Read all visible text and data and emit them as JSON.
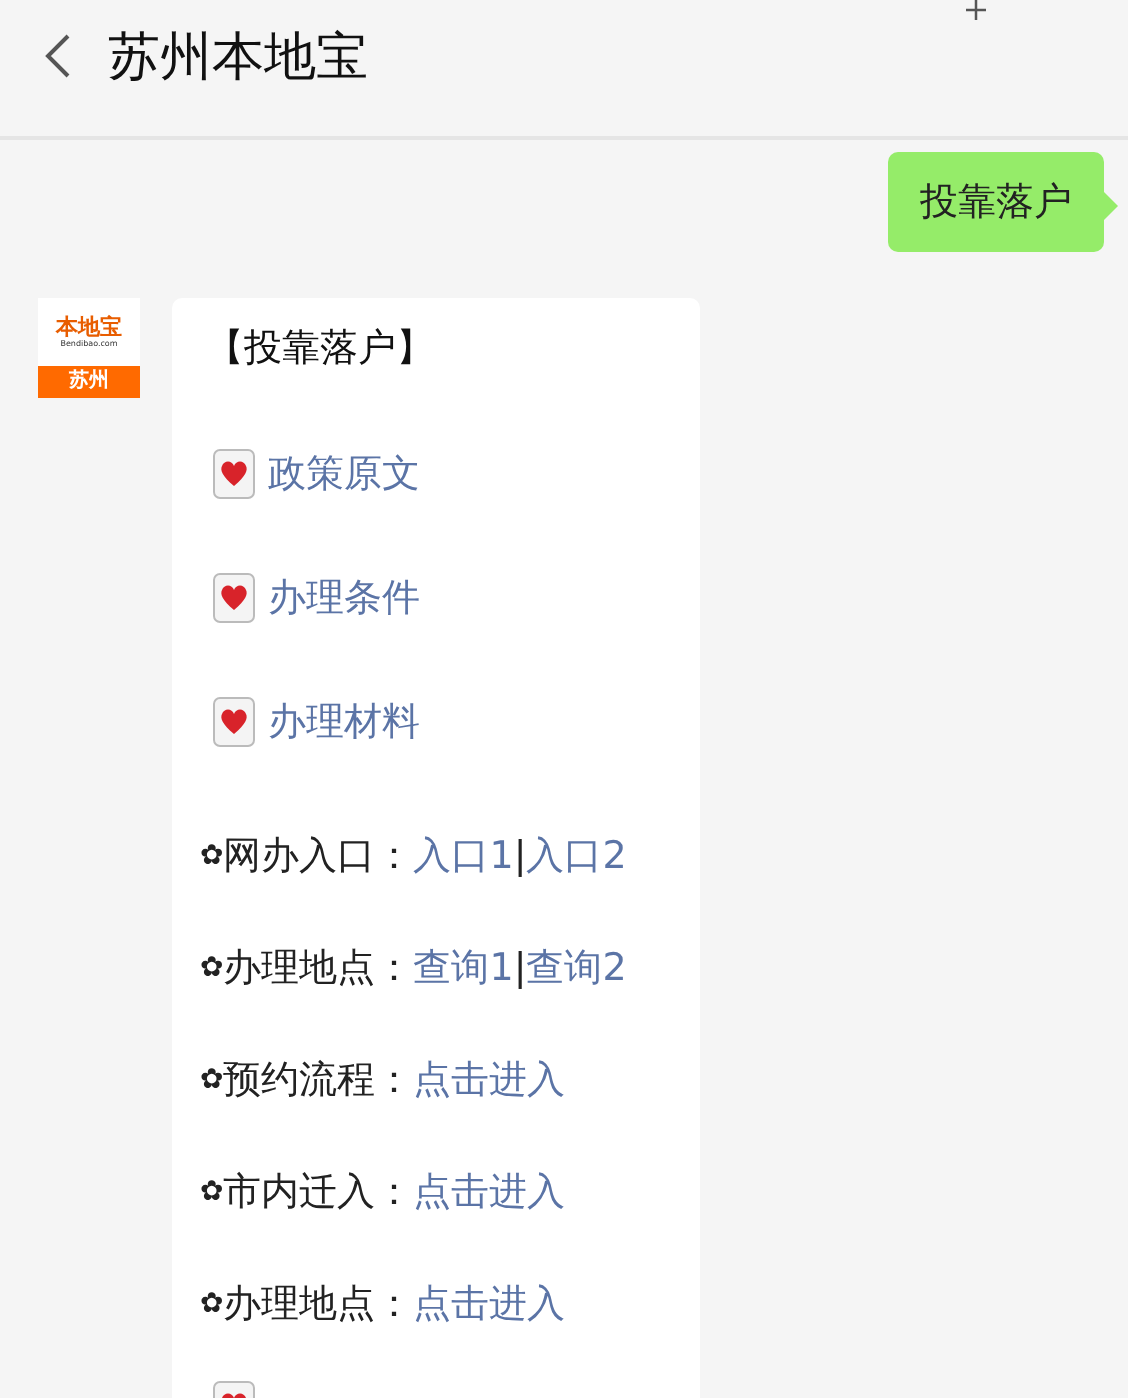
{
  "header": {
    "title": "苏州本地宝"
  },
  "outgoing_message": {
    "text": "投靠落户"
  },
  "incoming_message": {
    "avatar": {
      "brand": "本地宝",
      "domain": "Bendibao.com",
      "city": "苏州"
    },
    "title": "【投靠落户】",
    "items": [
      {
        "kind": "heart",
        "link": "政策原文"
      },
      {
        "kind": "heart",
        "link": "办理条件"
      },
      {
        "kind": "heart",
        "link": "办理材料"
      },
      {
        "kind": "flower",
        "bullet": "✿",
        "label": "网办入口：",
        "links": [
          "入口1",
          "入口2"
        ],
        "separator": "|"
      },
      {
        "kind": "flower",
        "bullet": "✿",
        "label": "办理地点：",
        "links": [
          "查询1",
          "查询2"
        ],
        "separator": "|"
      },
      {
        "kind": "flower",
        "bullet": "✿",
        "label": "预约流程：",
        "links": [
          "点击进入"
        ]
      },
      {
        "kind": "flower",
        "bullet": "✿",
        "label": "市内迁入：",
        "links": [
          "点击进入"
        ]
      },
      {
        "kind": "flower",
        "bullet": "✿",
        "label": "办理地点：",
        "links": [
          "点击进入"
        ]
      },
      {
        "kind": "heart"
      }
    ]
  }
}
